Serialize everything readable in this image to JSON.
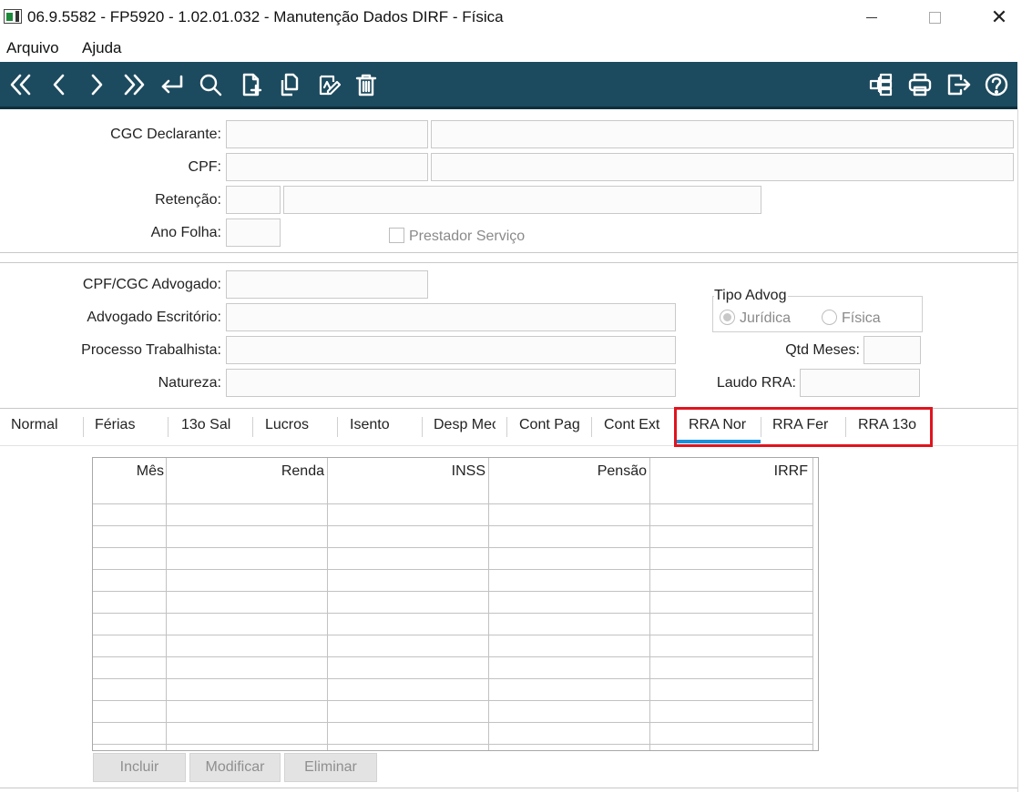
{
  "window": {
    "title": "06.9.5582 - FP5920 - 1.02.01.032 - Manutenção Dados DIRF - Física",
    "close_glyph": "✕"
  },
  "menu": {
    "items": [
      "Arquivo",
      "Ajuda"
    ]
  },
  "toolbar": {
    "icon_color": "#ffffff",
    "background": "#1c4a5e",
    "left_icons": [
      "first-record-icon",
      "previous-record-icon",
      "next-record-icon",
      "last-record-icon",
      "return-icon",
      "search-icon",
      "new-document-icon",
      "copy-icon",
      "edit-icon",
      "delete-icon"
    ],
    "right_icons": [
      "structure-icon",
      "print-icon",
      "exit-icon",
      "help-icon"
    ]
  },
  "form": {
    "cgc_label": "CGC Declarante:",
    "cpf_label": "CPF:",
    "retencao_label": "Retenção:",
    "ano_folha_label": "Ano Folha:",
    "prestador_label": "Prestador Serviço",
    "cpf_cgc_adv_label": "CPF/CGC Advogado:",
    "adv_escritorio_label": "Advogado Escritório:",
    "processo_label": "Processo Trabalhista:",
    "natureza_label": "Natureza:",
    "tipo_advog_label": "Tipo Advog",
    "juridica_label": "Jurídica",
    "fisica_label": "Física",
    "qtd_meses_label": "Qtd Meses:",
    "laudo_label": "Laudo RRA:"
  },
  "tabs": [
    "Normal",
    "Férias",
    "13o Sal",
    "Lucros",
    "Isento",
    "Desp Mec",
    "Cont Pag",
    "Cont Ext",
    "RRA Nor",
    "RRA Fer",
    "RRA 13o"
  ],
  "active_tab": "RRA Nor",
  "grid": {
    "columns": [
      "Mês",
      "Renda",
      "INSS",
      "Pensão",
      "IRRF"
    ]
  },
  "buttons": {
    "incluir": "Incluir",
    "modificar": "Modificar",
    "eliminar": "Eliminar"
  },
  "colors": {
    "accent_tab": "#1a8fd8",
    "highlight": "#e0141e"
  }
}
